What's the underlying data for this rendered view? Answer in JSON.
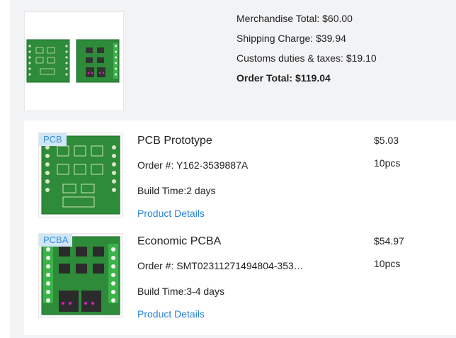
{
  "summary": {
    "merchandise_total": "Merchandise Total: $60.00",
    "shipping_charge": "Shipping Charge: $39.94",
    "customs": "Customs duties & taxes: $19.10",
    "order_total": "Order Total: $119.04"
  },
  "items": [
    {
      "tag": "PCB",
      "title": "PCB Prototype",
      "order_no": "Order #: Y162-3539887A",
      "build_time": "Build Time:2 days",
      "details_link": "Product Details",
      "price": "$5.03",
      "qty": "10pcs"
    },
    {
      "tag": "PCBA",
      "title": "Economic PCBA",
      "order_no": "Order #: SMT02311271494804-353…",
      "build_time": "Build Time:3-4 days",
      "details_link": "Product Details",
      "price": "$54.97",
      "qty": "10pcs"
    }
  ],
  "colors": {
    "pcb_green": "#2e8b3a",
    "pcb_dark": "#1f6e2b",
    "link_blue": "#2a83d6",
    "tag_bg": "#cfe6f7"
  }
}
